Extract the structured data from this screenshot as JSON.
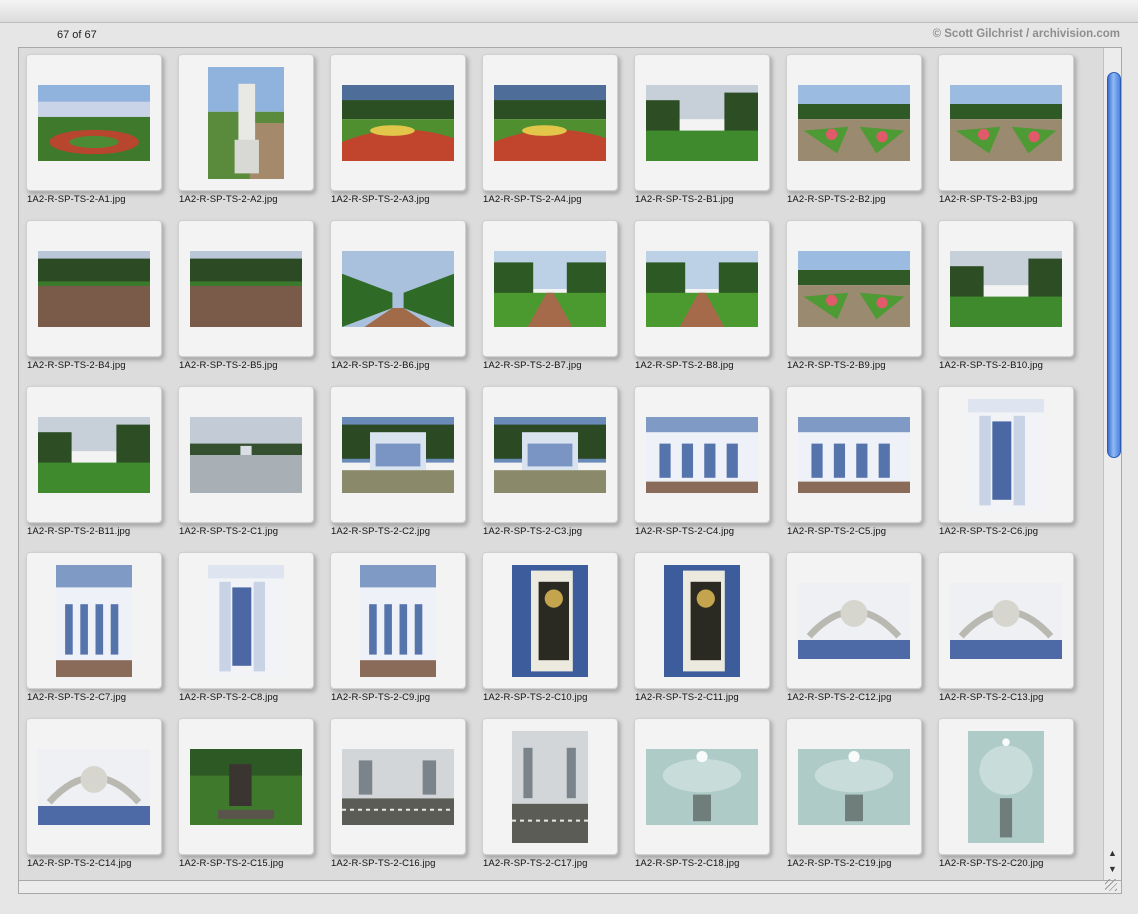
{
  "header": {
    "counter": "67 of 67",
    "copyright": "© Scott Gilchrist / archivision.com"
  },
  "thumbnails": [
    {
      "file": "1A2-R-SP-TS-2-A1.jpg",
      "orient": "h",
      "scene": "spiral"
    },
    {
      "file": "1A2-R-SP-TS-2-A2.jpg",
      "orient": "v",
      "scene": "statue"
    },
    {
      "file": "1A2-R-SP-TS-2-A3.jpg",
      "orient": "h",
      "scene": "parterre"
    },
    {
      "file": "1A2-R-SP-TS-2-A4.jpg",
      "orient": "h",
      "scene": "parterre"
    },
    {
      "file": "1A2-R-SP-TS-2-B1.jpg",
      "orient": "h",
      "scene": "lawn"
    },
    {
      "file": "1A2-R-SP-TS-2-B2.jpg",
      "orient": "h",
      "scene": "flowers"
    },
    {
      "file": "1A2-R-SP-TS-2-B3.jpg",
      "orient": "h",
      "scene": "flowers"
    },
    {
      "file": "1A2-R-SP-TS-2-B4.jpg",
      "orient": "h",
      "scene": "path"
    },
    {
      "file": "1A2-R-SP-TS-2-B5.jpg",
      "orient": "h",
      "scene": "path"
    },
    {
      "file": "1A2-R-SP-TS-2-B6.jpg",
      "orient": "h",
      "scene": "hedges"
    },
    {
      "file": "1A2-R-SP-TS-2-B7.jpg",
      "orient": "h",
      "scene": "alley"
    },
    {
      "file": "1A2-R-SP-TS-2-B8.jpg",
      "orient": "h",
      "scene": "alley"
    },
    {
      "file": "1A2-R-SP-TS-2-B9.jpg",
      "orient": "h",
      "scene": "flowers"
    },
    {
      "file": "1A2-R-SP-TS-2-B10.jpg",
      "orient": "h",
      "scene": "lawn"
    },
    {
      "file": "1A2-R-SP-TS-2-B11.jpg",
      "orient": "h",
      "scene": "lawn"
    },
    {
      "file": "1A2-R-SP-TS-2-C1.jpg",
      "orient": "h",
      "scene": "pond"
    },
    {
      "file": "1A2-R-SP-TS-2-C2.jpg",
      "orient": "h",
      "scene": "pavilion"
    },
    {
      "file": "1A2-R-SP-TS-2-C3.jpg",
      "orient": "h",
      "scene": "pavilion"
    },
    {
      "file": "1A2-R-SP-TS-2-C4.jpg",
      "orient": "h",
      "scene": "facade"
    },
    {
      "file": "1A2-R-SP-TS-2-C5.jpg",
      "orient": "h",
      "scene": "facade"
    },
    {
      "file": "1A2-R-SP-TS-2-C6.jpg",
      "orient": "v",
      "scene": "columns"
    },
    {
      "file": "1A2-R-SP-TS-2-C7.jpg",
      "orient": "v",
      "scene": "facade"
    },
    {
      "file": "1A2-R-SP-TS-2-C8.jpg",
      "orient": "v",
      "scene": "columns"
    },
    {
      "file": "1A2-R-SP-TS-2-C9.jpg",
      "orient": "v",
      "scene": "facade"
    },
    {
      "file": "1A2-R-SP-TS-2-C10.jpg",
      "orient": "v",
      "scene": "window"
    },
    {
      "file": "1A2-R-SP-TS-2-C11.jpg",
      "orient": "v",
      "scene": "window"
    },
    {
      "file": "1A2-R-SP-TS-2-C12.jpg",
      "orient": "h",
      "scene": "ornament"
    },
    {
      "file": "1A2-R-SP-TS-2-C13.jpg",
      "orient": "h",
      "scene": "ornament"
    },
    {
      "file": "1A2-R-SP-TS-2-C14.jpg",
      "orient": "h",
      "scene": "ornament"
    },
    {
      "file": "1A2-R-SP-TS-2-C15.jpg",
      "orient": "h",
      "scene": "sculpture"
    },
    {
      "file": "1A2-R-SP-TS-2-C16.jpg",
      "orient": "h",
      "scene": "interior"
    },
    {
      "file": "1A2-R-SP-TS-2-C17.jpg",
      "orient": "v",
      "scene": "interior"
    },
    {
      "file": "1A2-R-SP-TS-2-C18.jpg",
      "orient": "h",
      "scene": "ceiling"
    },
    {
      "file": "1A2-R-SP-TS-2-C19.jpg",
      "orient": "h",
      "scene": "ceiling"
    },
    {
      "file": "1A2-R-SP-TS-2-C20.jpg",
      "orient": "v",
      "scene": "ceiling"
    }
  ],
  "icons": {
    "scroll_up": "▲",
    "scroll_down": "▼"
  }
}
